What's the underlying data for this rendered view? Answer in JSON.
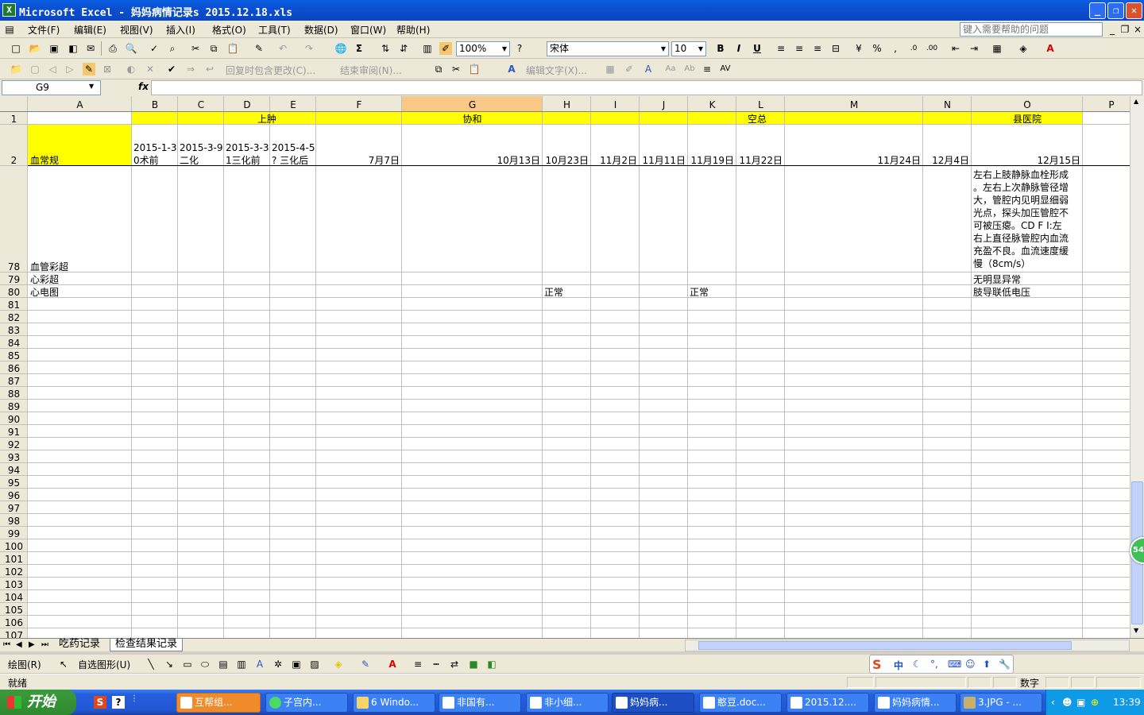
{
  "window": {
    "title": "Microsoft Excel - 妈妈病情记录s 2015.12.18.xls",
    "min": "_",
    "max": "❐",
    "close": "✕"
  },
  "menu": [
    "文件(F)",
    "编辑(E)",
    "视图(V)",
    "插入(I)",
    "格式(O)",
    "工具(T)",
    "数据(D)",
    "窗口(W)",
    "帮助(H)"
  ],
  "help_placeholder": "键入需要帮助的问题",
  "toolbar": {
    "zoom": "100%",
    "font": "宋体",
    "size": "10",
    "reply_changes": "回复时包含更改(C)...",
    "end_review": "结束审阅(N)...",
    "edit_text": "编辑文字(X)..."
  },
  "formula": {
    "namebox": "G9",
    "fx": "fx",
    "value": ""
  },
  "columns": [
    {
      "label": "",
      "w": 35
    },
    {
      "label": "A",
      "w": 131
    },
    {
      "label": "B",
      "w": 58
    },
    {
      "label": "C",
      "w": 58
    },
    {
      "label": "D",
      "w": 58
    },
    {
      "label": "E",
      "w": 58
    },
    {
      "label": "F",
      "w": 108
    },
    {
      "label": "G",
      "w": 177
    },
    {
      "label": "H",
      "w": 61
    },
    {
      "label": "I",
      "w": 61
    },
    {
      "label": "J",
      "w": 61
    },
    {
      "label": "K",
      "w": 61
    },
    {
      "label": "L",
      "w": 61
    },
    {
      "label": "M",
      "w": 174
    },
    {
      "label": "N",
      "w": 61
    },
    {
      "label": "O",
      "w": 140
    },
    {
      "label": "P",
      "w": 72
    }
  ],
  "selected_column": "G",
  "row1": {
    "num": "1",
    "shangzhong": "上肿",
    "xiehe": "协和",
    "kongzong": "空总",
    "xianyiyuan": "县医院"
  },
  "row2": {
    "num": "2",
    "A": "血常规",
    "B": "2015-1-30术前",
    "C": "2015-3-9二化",
    "D": "2015-3-31三化前",
    "E": "2015-4-5? 三化后",
    "F": "7月7日",
    "G": "10月13日",
    "H": "10月23日",
    "I": "11月2日",
    "J": "11月11日",
    "K": "11月19日",
    "L": "11月22日",
    "M": "11月24日",
    "N": "12月4日",
    "O": "12月15日"
  },
  "row78": {
    "num": "78",
    "A": "血管彩超",
    "O": "左右上肢静脉血栓形成。左右上次静脉管径增大，管腔内见明显细弱光点，探头加压管腔不可被压瘪。CD F I:左右上直径脉管腔内血流充盈不良。血流速度缓慢（8cm/s）"
  },
  "row79": {
    "num": "79",
    "A": "心彩超",
    "O": "无明显异常"
  },
  "row80": {
    "num": "80",
    "A": "心电图",
    "H": "正常",
    "K": "正常",
    "O": "肢导联低电压"
  },
  "empty_rows": [
    "81",
    "82",
    "83",
    "84",
    "85",
    "86",
    "87",
    "88",
    "89",
    "90",
    "91",
    "92",
    "93",
    "94",
    "95",
    "96",
    "97",
    "98",
    "99",
    "100",
    "101",
    "102",
    "103",
    "104",
    "105",
    "106",
    "107"
  ],
  "sheet_tabs": [
    "吃药记录",
    "检查结果记录"
  ],
  "draw": {
    "draw": "绘图(R)",
    "autoshape": "自选图形(U)"
  },
  "status": {
    "ready": "就绪",
    "numlock": "数字"
  },
  "tray_badge": "54",
  "taskbar": {
    "start": "开始",
    "items": [
      "互帮组...",
      "子宫内...",
      "6 Windo...",
      "非国有...",
      "非小细...",
      "妈妈病...",
      "憨豆.doc...",
      "2015.12....",
      "妈妈病情...",
      "3.JPG - ..."
    ],
    "clock": "13:39"
  },
  "colors": {
    "yellow": "#ffff00",
    "selected_header": "#f8c888",
    "header": "#ece9d8"
  }
}
